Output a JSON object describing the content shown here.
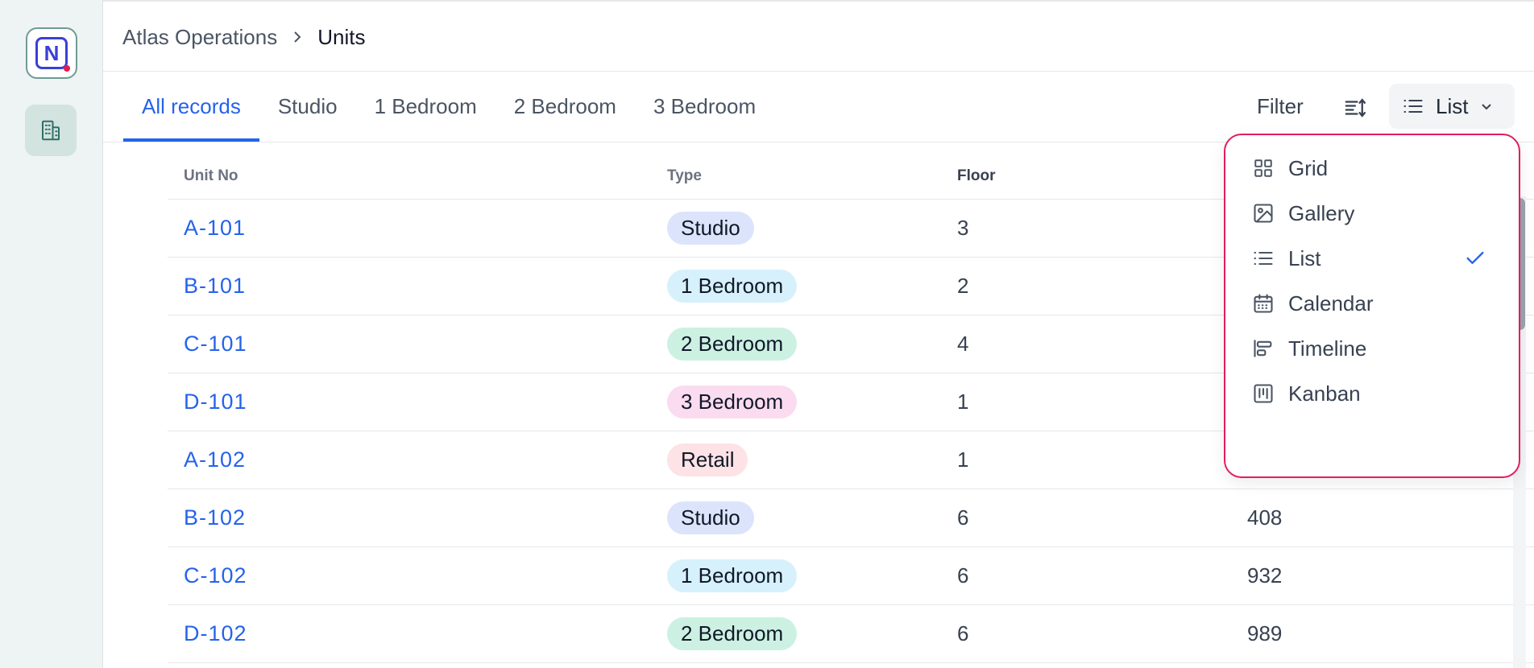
{
  "breadcrumb": {
    "root": "Atlas Operations",
    "current": "Units"
  },
  "tabs": [
    {
      "label": "All records",
      "active": true
    },
    {
      "label": "Studio",
      "active": false
    },
    {
      "label": "1 Bedroom",
      "active": false
    },
    {
      "label": "2 Bedroom",
      "active": false
    },
    {
      "label": "3 Bedroom",
      "active": false
    }
  ],
  "toolbar": {
    "filter_label": "Filter",
    "view_label": "List"
  },
  "table": {
    "headers": [
      "Unit No",
      "Type",
      "Floor"
    ],
    "rows": [
      {
        "unit": "A-101",
        "type": "Studio",
        "floor": "3",
        "extra": ""
      },
      {
        "unit": "B-101",
        "type": "1 Bedroom",
        "floor": "2",
        "extra": ""
      },
      {
        "unit": "C-101",
        "type": "2 Bedroom",
        "floor": "4",
        "extra": ""
      },
      {
        "unit": "D-101",
        "type": "3 Bedroom",
        "floor": "1",
        "extra": ""
      },
      {
        "unit": "A-102",
        "type": "Retail",
        "floor": "1",
        "extra": ""
      },
      {
        "unit": "B-102",
        "type": "Studio",
        "floor": "6",
        "extra": "408"
      },
      {
        "unit": "C-102",
        "type": "1 Bedroom",
        "floor": "6",
        "extra": "932"
      },
      {
        "unit": "D-102",
        "type": "2 Bedroom",
        "floor": "6",
        "extra": "989"
      }
    ]
  },
  "badge_colors": {
    "Studio": "#dbe4fb",
    "1 Bedroom": "#d6f1fb",
    "2 Bedroom": "#ccf1e3",
    "3 Bedroom": "#fbdbf0",
    "Retail": "#fde2e6"
  },
  "view_menu": {
    "items": [
      {
        "label": "Grid",
        "icon": "grid-icon"
      },
      {
        "label": "Gallery",
        "icon": "image-icon"
      },
      {
        "label": "List",
        "icon": "list-icon",
        "selected": true
      },
      {
        "label": "Calendar",
        "icon": "calendar-icon"
      },
      {
        "label": "Timeline",
        "icon": "timeline-icon"
      },
      {
        "label": "Kanban",
        "icon": "kanban-icon"
      }
    ]
  },
  "colors": {
    "accent": "#2563eb",
    "dropdown_border": "#e11d62"
  }
}
